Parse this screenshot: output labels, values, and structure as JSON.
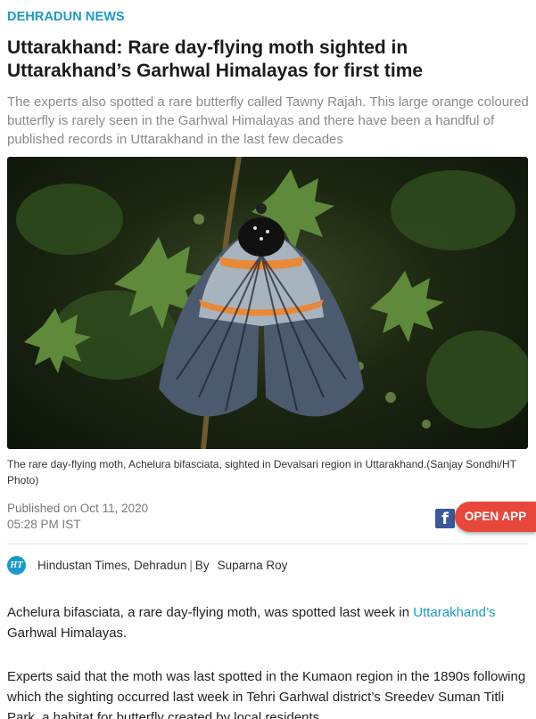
{
  "section": "DEHRADUN NEWS",
  "headline": "Uttarakhand: Rare day-flying moth sighted in Uttarakhand’s Garhwal Himalayas for first time",
  "summary": "The experts also spotted a rare butterfly called Tawny Rajah. This large orange coloured butterfly is rarely seen in the Garhwal Himalayas and there have been a handful of published records in Uttarakhand in the last few decades",
  "caption": "The rare day-flying moth, Achelura bifasciata, sighted in Devalsari region in Uttarakhand.(Sanjay Sondhi/HT Photo)",
  "published_line": "Published on Oct 11, 2020",
  "published_time": "05:28 PM IST",
  "share": {
    "facebook_icon": "facebook-icon",
    "facebook_glyph": "f"
  },
  "open_app_label": "OPEN APP",
  "byline": {
    "logo_text": "HT",
    "publisher": "Hindustan Times, Dehradun",
    "separator": "|",
    "by": "By",
    "author": "Suparna Roy"
  },
  "body": {
    "para1_before": "Achelura bifasciata, a rare day-flying moth, was spotted last week in ",
    "para1_link": "Uttarakhand’s",
    "para1_after": " Garhwal Himalayas.",
    "para2": "Experts said that the moth was last spotted in the Kumaon region in the 1890s following which the sighting occurred last week in Tehri Garhwal district’s Sreedev Suman Titli Park, a habitat for butterfly created by local residents."
  },
  "colors": {
    "accent": "#1a9bc7",
    "open_app": "#e8473b",
    "facebook": "#3b5998"
  }
}
